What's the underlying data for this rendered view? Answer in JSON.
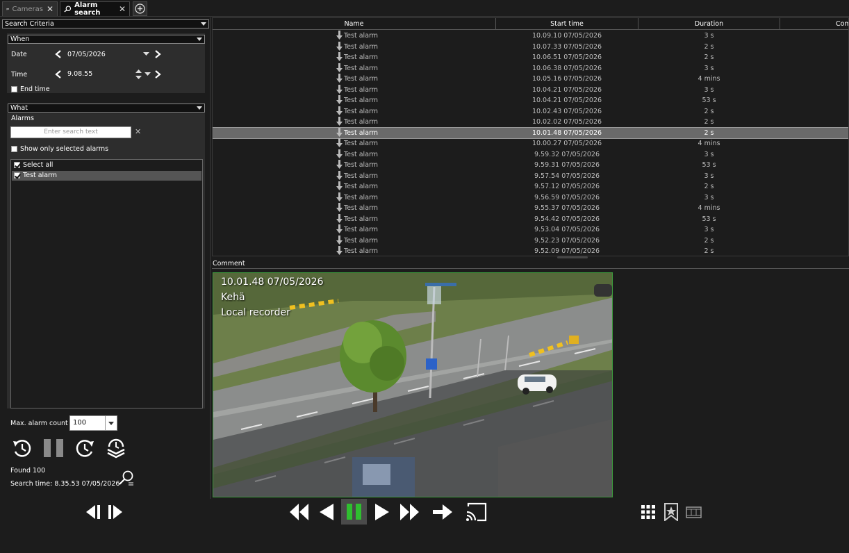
{
  "tabs": [
    {
      "label": "Cameras",
      "icon": "camera-icon",
      "active": false
    },
    {
      "label": "Alarm search",
      "icon": "alarm-search-icon",
      "active": true
    }
  ],
  "left": {
    "criteria_header": "Search Criteria",
    "when": {
      "header": "When",
      "date_label": "Date",
      "date_value": "07/05/2026",
      "time_label": "Time",
      "time_value": "9.08.55",
      "end_time_label": "End time"
    },
    "what": {
      "header": "What",
      "alarms_label": "Alarms",
      "search_placeholder": "Enter search text",
      "show_only_selected_label": "Show only selected alarms",
      "list": [
        {
          "label": "Select all",
          "checked": true,
          "selected": false
        },
        {
          "label": "Test alarm",
          "checked": true,
          "selected": true
        }
      ]
    },
    "max_alarm_count_label": "Max. alarm count",
    "max_alarm_count_value": "100",
    "found": "Found 100",
    "search_time": "Search time: 8.35.53  07/05/2026"
  },
  "table": {
    "columns": [
      "Name",
      "Start time",
      "Duration",
      "Com"
    ],
    "rows": [
      {
        "name": "Test alarm",
        "start": "10.09.10  07/05/2026",
        "duration": "3 s"
      },
      {
        "name": "Test alarm",
        "start": "10.07.33  07/05/2026",
        "duration": "2 s"
      },
      {
        "name": "Test alarm",
        "start": "10.06.51  07/05/2026",
        "duration": "2 s"
      },
      {
        "name": "Test alarm",
        "start": "10.06.38  07/05/2026",
        "duration": "3 s"
      },
      {
        "name": "Test alarm",
        "start": "10.05.16  07/05/2026",
        "duration": "4 mins"
      },
      {
        "name": "Test alarm",
        "start": "10.04.21  07/05/2026",
        "duration": "3 s"
      },
      {
        "name": "Test alarm",
        "start": "10.04.21  07/05/2026",
        "duration": "53 s"
      },
      {
        "name": "Test alarm",
        "start": "10.02.43  07/05/2026",
        "duration": "2 s"
      },
      {
        "name": "Test alarm",
        "start": "10.02.02  07/05/2026",
        "duration": "2 s"
      },
      {
        "name": "Test alarm",
        "start": "10.01.48  07/05/2026",
        "duration": "2 s",
        "selected": true
      },
      {
        "name": "Test alarm",
        "start": "10.00.27  07/05/2026",
        "duration": "4 mins"
      },
      {
        "name": "Test alarm",
        "start": "9.59.32  07/05/2026",
        "duration": "3 s"
      },
      {
        "name": "Test alarm",
        "start": "9.59.31  07/05/2026",
        "duration": "53 s"
      },
      {
        "name": "Test alarm",
        "start": "9.57.54  07/05/2026",
        "duration": "3 s"
      },
      {
        "name": "Test alarm",
        "start": "9.57.12  07/05/2026",
        "duration": "2 s"
      },
      {
        "name": "Test alarm",
        "start": "9.56.59  07/05/2026",
        "duration": "3 s"
      },
      {
        "name": "Test alarm",
        "start": "9.55.37  07/05/2026",
        "duration": "4 mins"
      },
      {
        "name": "Test alarm",
        "start": "9.54.42  07/05/2026",
        "duration": "53 s"
      },
      {
        "name": "Test alarm",
        "start": "9.53.04  07/05/2026",
        "duration": "3 s"
      },
      {
        "name": "Test alarm",
        "start": "9.52.23  07/05/2026",
        "duration": "2 s"
      },
      {
        "name": "Test alarm",
        "start": "9.52.09  07/05/2026",
        "duration": "2 s"
      }
    ]
  },
  "comment_label": "Comment",
  "video": {
    "timestamp": "10.01.48  07/05/2026",
    "camera_name": "Kehä",
    "source": "Local recorder"
  },
  "colors": {
    "accent_green": "#2fbf2f",
    "selected_row": "#6a6a6a",
    "video_border": "#3c9a3c"
  }
}
